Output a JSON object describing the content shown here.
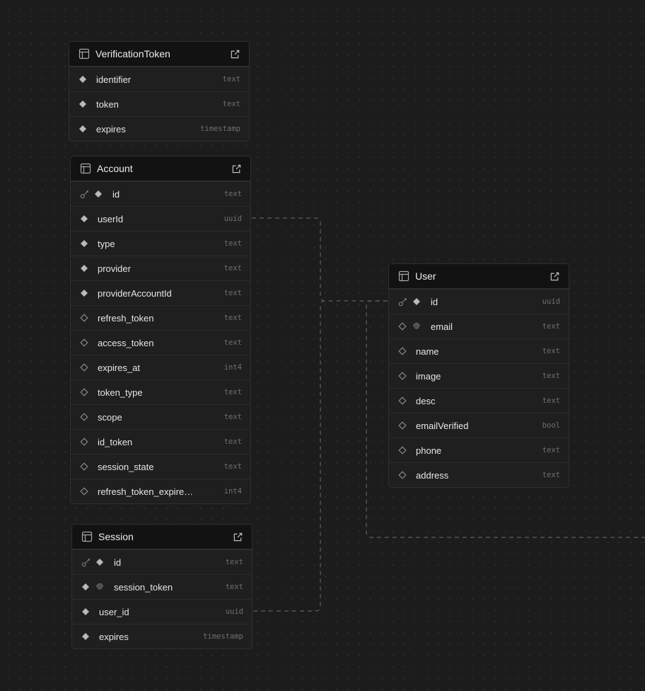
{
  "tables": {
    "verification": {
      "name": "VerificationToken",
      "columns": [
        {
          "name": "identifier",
          "type": "text"
        },
        {
          "name": "token",
          "type": "text"
        },
        {
          "name": "expires",
          "type": "timestamp"
        }
      ]
    },
    "account": {
      "name": "Account",
      "columns": [
        {
          "name": "id",
          "type": "text"
        },
        {
          "name": "userId",
          "type": "uuid"
        },
        {
          "name": "type",
          "type": "text"
        },
        {
          "name": "provider",
          "type": "text"
        },
        {
          "name": "providerAccountId",
          "type": "text"
        },
        {
          "name": "refresh_token",
          "type": "text"
        },
        {
          "name": "access_token",
          "type": "text"
        },
        {
          "name": "expires_at",
          "type": "int4"
        },
        {
          "name": "token_type",
          "type": "text"
        },
        {
          "name": "scope",
          "type": "text"
        },
        {
          "name": "id_token",
          "type": "text"
        },
        {
          "name": "session_state",
          "type": "text"
        },
        {
          "name": "refresh_token_expire…",
          "type": "int4"
        }
      ]
    },
    "user": {
      "name": "User",
      "columns": [
        {
          "name": "id",
          "type": "uuid"
        },
        {
          "name": "email",
          "type": "text"
        },
        {
          "name": "name",
          "type": "text"
        },
        {
          "name": "image",
          "type": "text"
        },
        {
          "name": "desc",
          "type": "text"
        },
        {
          "name": "emailVerified",
          "type": "bool"
        },
        {
          "name": "phone",
          "type": "text"
        },
        {
          "name": "address",
          "type": "text"
        }
      ]
    },
    "session": {
      "name": "Session",
      "columns": [
        {
          "name": "id",
          "type": "text"
        },
        {
          "name": "session_token",
          "type": "text"
        },
        {
          "name": "user_id",
          "type": "uuid"
        },
        {
          "name": "expires",
          "type": "timestamp"
        }
      ]
    }
  },
  "colors": {
    "canvas": "#1c1c1c",
    "header": "#121212",
    "body": "#1f1f1f",
    "edge": "#6a6a6a"
  }
}
